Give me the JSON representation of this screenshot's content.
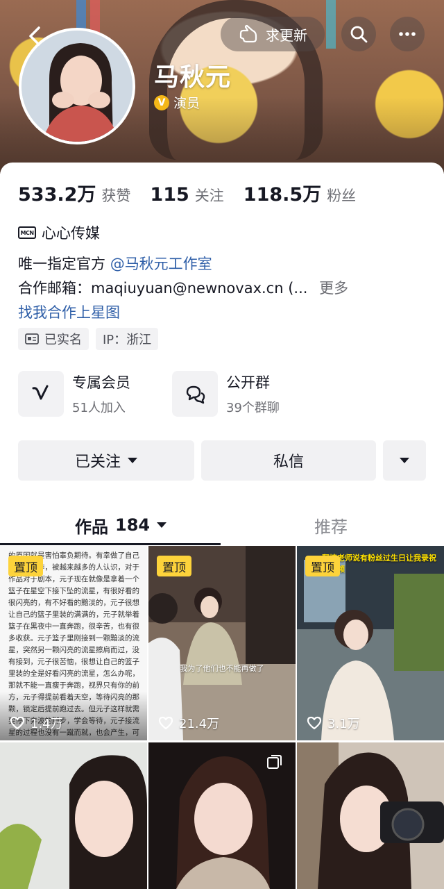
{
  "header": {
    "name": "马秋元",
    "verify_badge_glyph": "V",
    "verify_label": "演员",
    "update_label": "求更新",
    "icons": [
      "back-icon",
      "hand-point-icon",
      "search-icon",
      "more-icon"
    ]
  },
  "stats": [
    {
      "value": "533.2万",
      "label": "获赞"
    },
    {
      "value": "115",
      "label": "关注"
    },
    {
      "value": "118.5万",
      "label": "粉丝"
    }
  ],
  "mcn": {
    "badge": "MCN",
    "label": "心心传媒"
  },
  "bio": {
    "line1_prefix": "唯一指定官方",
    "line1_mention": "@马秋元工作室",
    "line2": "合作邮箱：maqiuyuan@newnovax.cn (...",
    "line2_more": "更多",
    "line3": "找我合作上星图"
  },
  "tags": {
    "verified": "已实名",
    "ip": "IP：浙江"
  },
  "perks": [
    {
      "title": "专属会员",
      "subtitle": "51人加入",
      "icon": "v-membership-icon"
    },
    {
      "title": "公开群",
      "subtitle": "39个群聊",
      "icon": "chat-bubbles-icon"
    }
  ],
  "actions": {
    "follow": "已关注",
    "message": "私信"
  },
  "tabs": {
    "works_label": "作品",
    "works_count": "184",
    "recommend_label": "推荐"
  },
  "videos": [
    {
      "pinned": "置顶",
      "likes": "1.4万",
      "text": "的原因就是害怕辜负期待。有幸做了自己喜欢的工作，被越来越多的人认识，对于作品对于剧本，元子现在就像是拿着一个篮子在星空下接下坠的流星，有很好看的很闪亮的，有不好看的黯淡的，元子很想让自己的篮子里装的满满的，元子就举着篮子在黑夜中一直奔跑，很辛苦，也有很多收获。元子篮子里刚接到一颗黯淡的流星，突然另一颗闪亮的流星擦肩而过，没有接到，元子很苦恼，很想让自己的篮子里装的全是好看闪亮的流星，怎么办呢，那就不能一直瘦于奔跑，视界只有你的前方，元子得提前看着天空，等待闪亮的那颗，锁定后提前跑过去。但元子这样就需要停下奔波的脚步，学会等待，元子接流星的过程也没有一蹴而就，也会产生，可能这个过程"
    },
    {
      "pinned": "置顶",
      "likes": "21.4万",
      "caption": "我为了他们也不能再做了"
    },
    {
      "pinned": "置顶",
      "likes": "3.1万",
      "top_text": "翻墙老师说有粉丝过生日让我录祝福视频"
    },
    {},
    {
      "multi": true
    },
    {}
  ],
  "colors": {
    "accent_link": "#2f5fa8",
    "pin_yellow": "#fdd33b",
    "verify_gold": "#f5b718"
  }
}
